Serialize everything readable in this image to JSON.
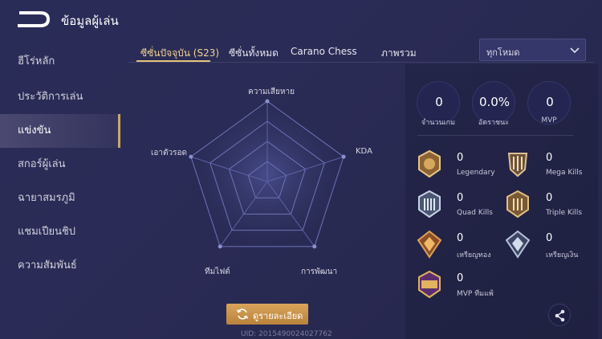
{
  "header": {
    "title": "ข้อมูลผู้เล่น"
  },
  "sidebar": {
    "items": [
      {
        "label": "ฮีโร่หลัก"
      },
      {
        "label": "ประวัติการเล่น"
      },
      {
        "label": "แข่งขัน"
      },
      {
        "label": "สกอร์ผู้เล่น"
      },
      {
        "label": "ฉายาสมรภูมิ"
      },
      {
        "label": "แชมเปียนชิป"
      },
      {
        "label": "ความสัมพันธ์"
      }
    ],
    "active_index": 2
  },
  "tabs": [
    {
      "label": "ซีซั่นปัจจุบัน (S23)"
    },
    {
      "label": "ซีซั่นทั้งหมด"
    },
    {
      "label": "Carano Chess"
    },
    {
      "label": "ภาพรวม"
    }
  ],
  "filter": {
    "selected": "ทุกโหมด"
  },
  "radar": {
    "axes": [
      "ความเสียหาย",
      "KDA",
      "การพัฒนา",
      "ทีมไฟต์",
      "เอาตัวรอด"
    ]
  },
  "detail_button": {
    "label": "ดูรายละเอียด"
  },
  "uid": "UID: 2015490024027762",
  "stats": [
    {
      "value": "0",
      "label": "จำนวนเกม"
    },
    {
      "value": "0.0%",
      "label": "อัตราชนะ"
    },
    {
      "value": "0",
      "label": "MVP"
    }
  ],
  "badges": [
    {
      "value": "0",
      "label": "Legendary",
      "icon": "legendary-badge-icon"
    },
    {
      "value": "0",
      "label": "Mega Kills",
      "icon": "mega-kills-badge-icon"
    },
    {
      "value": "0",
      "label": "Quad Kills",
      "icon": "quad-kills-badge-icon"
    },
    {
      "value": "0",
      "label": "Triple Kills",
      "icon": "triple-kills-badge-icon"
    },
    {
      "value": "0",
      "label": "เหรียญทอง",
      "icon": "gold-medal-icon"
    },
    {
      "value": "0",
      "label": "เหรียญเงิน",
      "icon": "silver-medal-icon"
    },
    {
      "value": "0",
      "label": "MVP ทีมแพ้",
      "icon": "mvp-losing-team-badge-icon"
    }
  ],
  "colors": {
    "accent_gold": "#e5c37d",
    "button_gold": "#c9914a",
    "background": "#2a2b55"
  }
}
